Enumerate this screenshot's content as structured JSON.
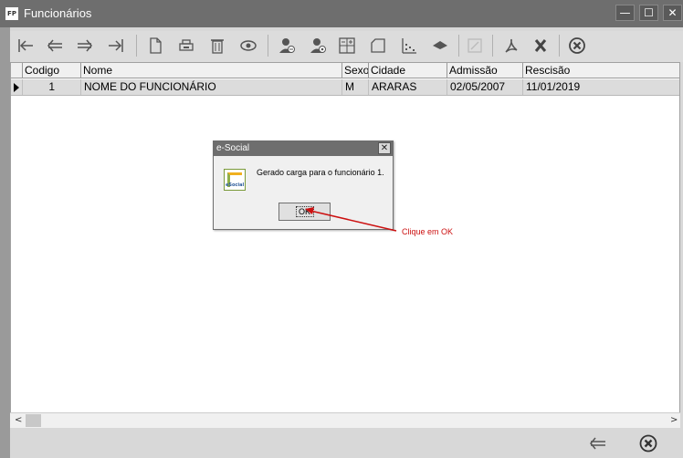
{
  "window": {
    "app_icon_text": "FP",
    "title": "Funcionários",
    "minimize": "—",
    "maximize": "☐",
    "close": "✕"
  },
  "toolbar": {
    "buttons": [
      "first-record-icon",
      "previous-record-icon",
      "next-record-icon",
      "last-record-icon",
      "new-document-icon",
      "print-icon",
      "delete-icon",
      "view-icon",
      "user-plus-icon",
      "user-search-icon",
      "calculator-icon",
      "folder-icon",
      "chart-icon",
      "esocial-icon",
      "edit-disabled-icon",
      "pdf-icon",
      "excel-icon",
      "close-circle-icon"
    ]
  },
  "grid": {
    "columns": [
      "Codigo",
      "Nome",
      "Sexo",
      "Cidade",
      "Admissão",
      "Rescisão"
    ],
    "rows": [
      {
        "codigo": "1",
        "nome": "NOME DO FUNCIONÁRIO",
        "sexo": "M",
        "cidade": "ARARAS",
        "admissao": "02/05/2007",
        "rescisao": "11/01/2019"
      }
    ]
  },
  "dialog": {
    "title": "e-Social",
    "close": "✕",
    "icon_label": "eSocial",
    "message": "Gerado carga para o funcionário 1.",
    "ok_label": "OK"
  },
  "annotation": {
    "text": "Clique em OK",
    "color": "#cc1010"
  },
  "scrollbar": {
    "left_arrow": "<",
    "right_arrow": ">"
  }
}
